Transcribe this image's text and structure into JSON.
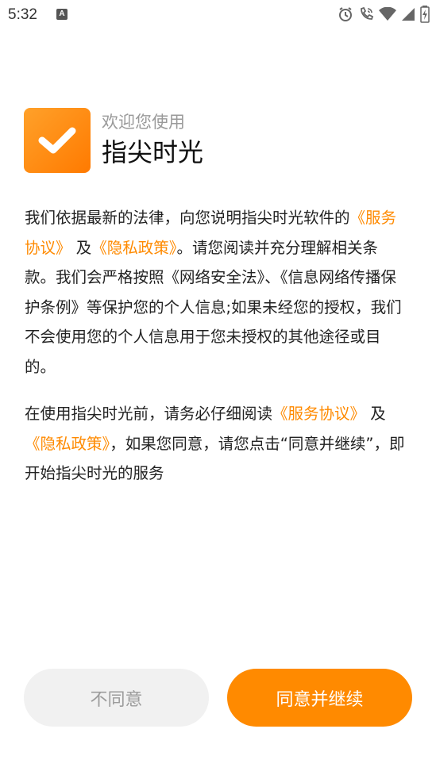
{
  "status_bar": {
    "time": "5:32",
    "left_icon": "A",
    "icons": [
      "alarm-icon",
      "wifi-calling-icon",
      "wifi-icon",
      "signal-icon",
      "battery-icon"
    ]
  },
  "header": {
    "welcome": "欢迎您使用",
    "app_name": "指尖时光"
  },
  "paragraph1": {
    "line1": "我们依据最新的法律，向您说明指尖时光软件的",
    "link_service": "《服务协议》",
    "and": "及",
    "link_privacy": "《隐私政策》",
    "rest": "。请您阅读并充分理解相关条款。我们会严格按照《网络安全法》、《信息网络传播保护条例》等保护您的个人信息;如果未经您的授权，我们不会使用您的个人信息用于您未授权的其他途径或目的。"
  },
  "paragraph2": {
    "lead": "在使用指尖时光前，请务必仔细阅读",
    "link_service": "《服务协议》",
    "and": "及",
    "link_privacy": "《隐私政策》",
    "rest": "，如果您同意，请您点击“同意并继续”，即开始指尖时光的服务"
  },
  "buttons": {
    "disagree": "不同意",
    "agree": "同意并继续"
  },
  "colors": {
    "accent": "#ff8a00",
    "disabled_bg": "#f1f1f1",
    "disabled_text": "#9c9c9c"
  }
}
